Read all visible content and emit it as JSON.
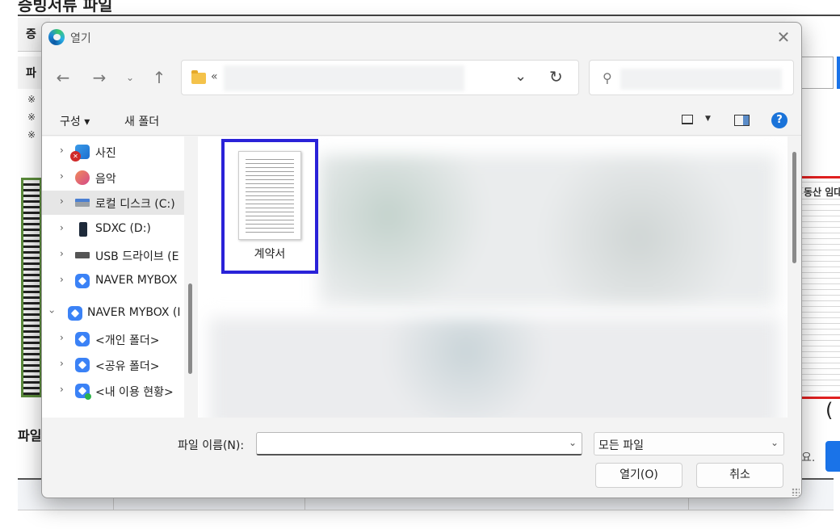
{
  "background": {
    "heading": "증빙서류 파일",
    "box1_text": "증",
    "box2_text": "파",
    "notes": [
      "※",
      "※",
      "※"
    ],
    "doc_right_title": "동산 임대",
    "paren": "(",
    "file_label": "파일",
    "trailing_text": "요."
  },
  "dialog": {
    "title": "열기",
    "address": {
      "separator": "«"
    },
    "toolbar": {
      "organize_label": "구성 ▾",
      "new_folder_label": "새 폴더"
    },
    "nav_items": [
      {
        "label": "사진",
        "icon": "photos-icon"
      },
      {
        "label": "음악",
        "icon": "music-icon"
      },
      {
        "label": "로컬 디스크 (C:)",
        "icon": "local-disk-icon",
        "selected": true
      },
      {
        "label": "SDXC (D:)",
        "icon": "sd-card-icon"
      },
      {
        "label": "USB 드라이브 (E",
        "icon": "usb-drive-icon"
      },
      {
        "label": "NAVER MYBOX",
        "icon": "mybox-icon"
      },
      {
        "label": "NAVER MYBOX (I",
        "icon": "mybox-icon",
        "expanded": true
      },
      {
        "label": "<개인 폴더>",
        "icon": "mybox-folder-icon"
      },
      {
        "label": "<공유 폴더>",
        "icon": "mybox-folder-icon"
      },
      {
        "label": "<내 이용 현황>",
        "icon": "mybox-status-icon"
      }
    ],
    "files": [
      {
        "name": "계약서",
        "selected": true
      }
    ],
    "filename_label": "파일 이름(N):",
    "filename_value": "",
    "filetype_value": "모든 파일",
    "open_button": "열기(O)",
    "cancel_button": "취소"
  }
}
